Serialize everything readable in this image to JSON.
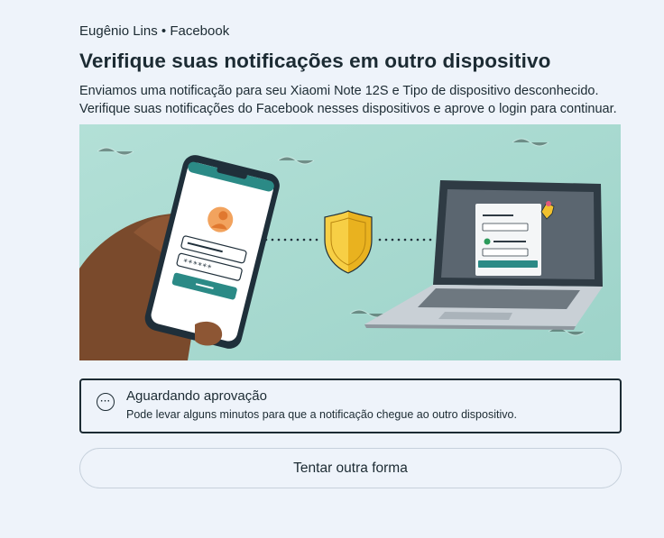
{
  "header": {
    "account": "Eugênio Lins • Facebook",
    "title": "Verifique suas notificações em outro dispositivo",
    "description": "Enviamos uma notificação para seu Xiaomi Note 12S e Tipo de dispositivo desconhecido. Verifique suas notificações do Facebook nesses dispositivos e aprove o login para continuar."
  },
  "illustration": {
    "password_mask": "******"
  },
  "status": {
    "icon": "more-dots-icon",
    "icon_glyph": "···",
    "title": "Aguardando aprovação",
    "subtitle": "Pode levar alguns minutos para que a notificação chegue ao outro dispositivo."
  },
  "actions": {
    "try_another_way": "Tentar outra forma"
  },
  "colors": {
    "text": "#1c2b33",
    "background": "#eef3fa",
    "illustration_bg": "#a8d9d0",
    "accent_teal": "#2b8a86",
    "shield": "#f2c12e"
  }
}
